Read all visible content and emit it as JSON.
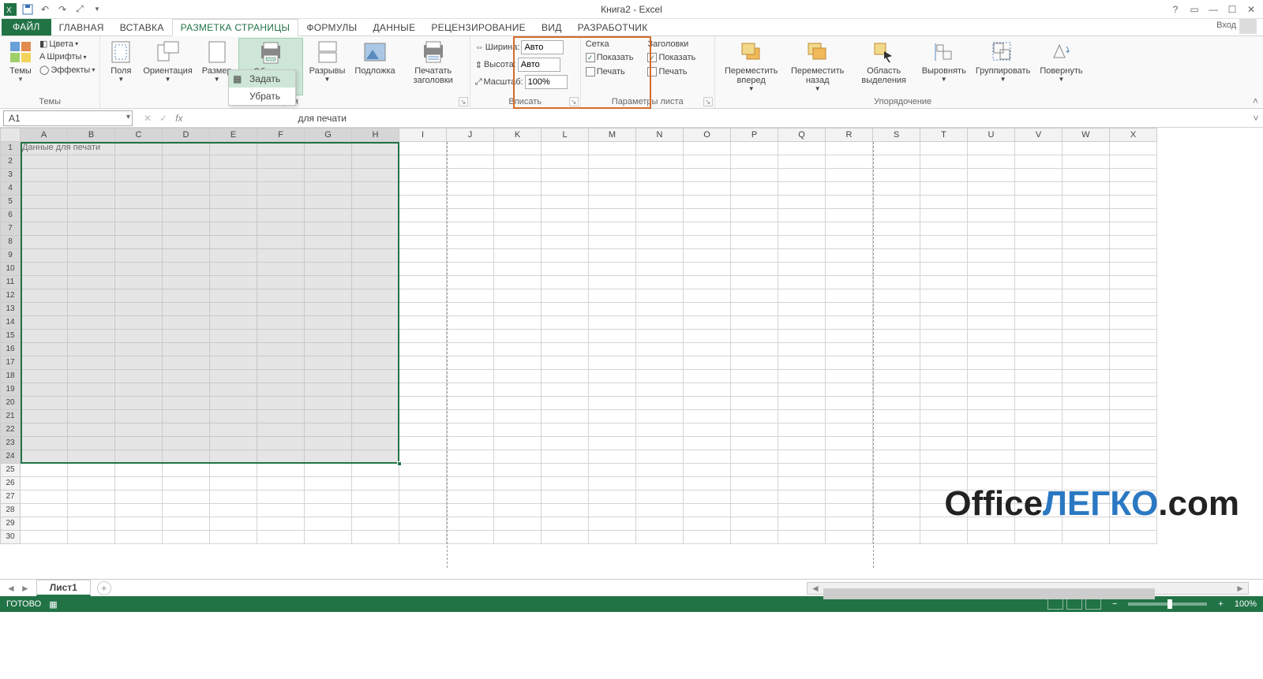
{
  "title": "Книга2 - Excel",
  "qat_icons": [
    "excel",
    "save",
    "undo",
    "redo",
    "preview"
  ],
  "login_text": "Вход",
  "tabs": {
    "file": "ФАЙЛ",
    "home": "ГЛАВНАЯ",
    "insert": "ВСТАВКА",
    "pagelayout": "РАЗМЕТКА СТРАНИЦЫ",
    "formulas": "ФОРМУЛЫ",
    "data": "ДАННЫЕ",
    "review": "РЕЦЕНЗИРОВАНИЕ",
    "view": "ВИД",
    "developer": "РАЗРАБОТЧИК"
  },
  "ribbon": {
    "themes": {
      "label": "Темы",
      "themes_btn": "Темы",
      "colors": "Цвета",
      "fonts": "Шрифты",
      "effects": "Эффекты"
    },
    "pagesetup": {
      "label": "Парам",
      "margins": "Поля",
      "orientation": "Ориентация",
      "size": "Размер",
      "printarea": "Область печати",
      "breaks": "Разрывы",
      "background": "Подложка",
      "printtitles": "Печатать заголовки"
    },
    "scale": {
      "label": "Вписать",
      "width": "Ширина:",
      "height": "Высота:",
      "scale": "Масштаб:",
      "auto": "Авто",
      "scaleval": "100%"
    },
    "sheetopts": {
      "label": "Параметры листа",
      "grid": "Сетка",
      "headings": "Заголовки",
      "show": "Показать",
      "print": "Печать"
    },
    "arrange": {
      "label": "Упорядочение",
      "forward": "Переместить вперед",
      "backward": "Переместить назад",
      "selection": "Область выделения",
      "align": "Выровнять",
      "group": "Группировать",
      "rotate": "Повернуть"
    }
  },
  "printarea_menu": {
    "set": "Задать",
    "clear": "Убрать"
  },
  "name_box": "A1",
  "formula_partial": "для печати",
  "columns": [
    "A",
    "B",
    "C",
    "D",
    "E",
    "F",
    "G",
    "H",
    "I",
    "J",
    "K",
    "L",
    "M",
    "N",
    "O",
    "P",
    "Q",
    "R",
    "S",
    "T",
    "U",
    "V",
    "W",
    "X"
  ],
  "rows": [
    1,
    2,
    3,
    4,
    5,
    6,
    7,
    8,
    9,
    10,
    11,
    12,
    13,
    14,
    15,
    16,
    17,
    18,
    19,
    20,
    21,
    22,
    23,
    24,
    25,
    26,
    27,
    28,
    29,
    30
  ],
  "sel_cols": 8,
  "sel_rows": 24,
  "cell_a1": "Данные для печати",
  "sheet_tab": "Лист1",
  "status_ready": "ГОТОВО",
  "zoom": "100%",
  "watermark": {
    "p1": "Office",
    "p2": "ЛЕГКО",
    "p3": ".com"
  }
}
